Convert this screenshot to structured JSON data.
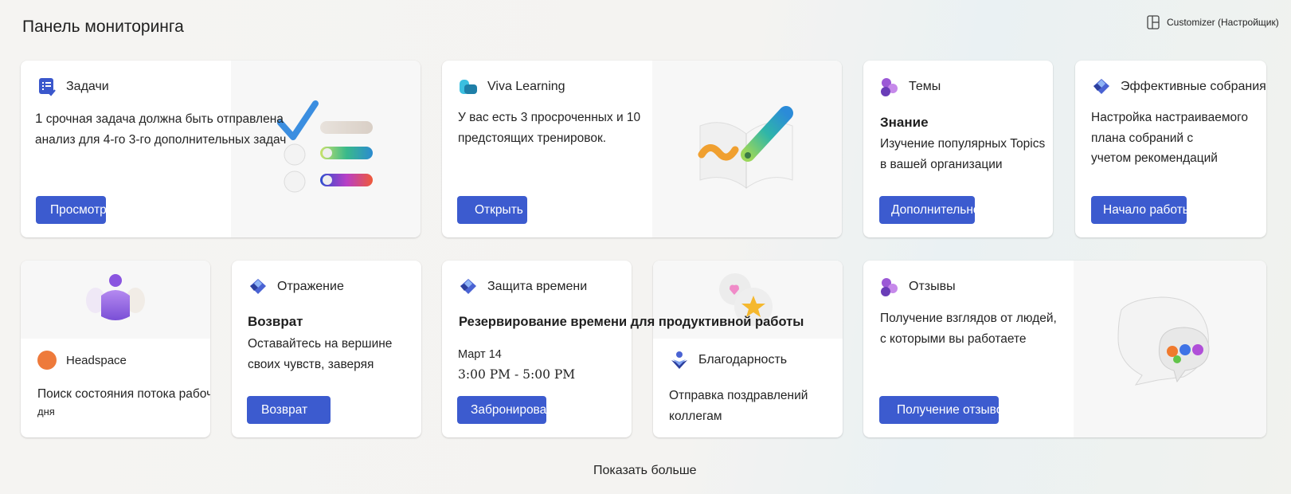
{
  "page": {
    "title": "Панель мониторинга"
  },
  "customizer": {
    "label": "Customizer (Настройщик)",
    "icon": "layout-panel-icon"
  },
  "cards": {
    "tasks": {
      "title": "Задачи",
      "count": "1",
      "text_line1": "срочная задача должна быть отправлена",
      "text_line2": "анализ для 4-го 3-го дополнительных задач",
      "button": "Просмотреть",
      "icon": "tasks-icon"
    },
    "viva_learning": {
      "title": "Viva Learning",
      "text_line1": "У вас есть 3 просроченных и 10",
      "text_line2": "предстоящих тренировок.",
      "button": "Открыть",
      "icon": "viva-learning-icon"
    },
    "topics": {
      "title": "Темы",
      "subtitle": "Знание",
      "text_line1": "Изучение популярных Topics",
      "text_line2": "в вашей организации",
      "button": "Дополнительно",
      "icon": "topics-icon"
    },
    "meetings": {
      "title": "Эффективные собрания",
      "text_line1": "Настройка настраиваемого",
      "text_line2": "плана собраний с",
      "text_line3": "учетом рекомендаций",
      "button": "Начало работы",
      "icon": "viva-insights-icon"
    },
    "headspace": {
      "title": "Headspace",
      "text_line1": "Поиск состояния потока рабочего",
      "text_line2": "дня",
      "icon": "headspace-icon"
    },
    "reflection": {
      "title": "Отражение",
      "subtitle": "Возврат",
      "text_line1": "Оставайтесь на вершине",
      "text_line2": "своих чувств, заверяя",
      "button": "Возврат",
      "icon": "viva-insights-icon"
    },
    "protect_time": {
      "title": "Защита времени",
      "subtitle": "Резервирование времени для продуктивной работы",
      "date": "Март 14",
      "time": "3:00 PM - 5:00 PM",
      "button": "Забронировать",
      "icon": "viva-insights-icon"
    },
    "praise": {
      "title": "Благодарность",
      "text_line1": "Отправка поздравлений",
      "text_line2": "коллегам",
      "icon": "praise-icon"
    },
    "feedback": {
      "title": "Отзывы",
      "text_line1": "Получение взглядов от людей,",
      "text_line2": "с которыми вы работаете",
      "button": "Получение отзывов",
      "icon": "feedback-icon"
    }
  },
  "footer": {
    "show_more": "Показать больше"
  },
  "colors": {
    "button": "#3c5bcf",
    "accent_purple": "#8a5bd6",
    "headspace_orange": "#ee7a3b",
    "insights_blue": "#4a63d3"
  }
}
